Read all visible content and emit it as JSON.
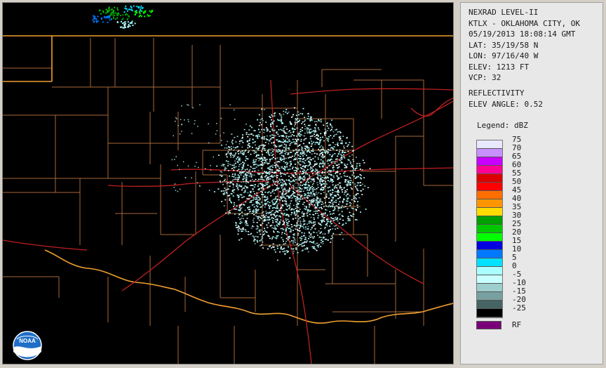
{
  "header": {
    "product_line": "NEXRAD LEVEL-II",
    "station": "KTLX - OKLAHOMA CITY, OK",
    "datetime": "05/19/2013 18:08:14 GMT",
    "lat": "LAT: 35/19/58 N",
    "lon": "LON: 97/16/40 W",
    "elev": "ELEV: 1213 FT",
    "vcp": "VCP: 32"
  },
  "product": {
    "name": "REFLECTIVITY",
    "elev_angle": "ELEV ANGLE: 0.52"
  },
  "legend": {
    "title": "Legend: dBZ",
    "levels": [
      {
        "label": "75",
        "color": "#e8e8ff"
      },
      {
        "label": "70",
        "color": "#c890ff"
      },
      {
        "label": "65",
        "color": "#c800ff"
      },
      {
        "label": "60",
        "color": "#ff0096"
      },
      {
        "label": "55",
        "color": "#dc0000"
      },
      {
        "label": "50",
        "color": "#ff0000"
      },
      {
        "label": "45",
        "color": "#ff6e00"
      },
      {
        "label": "40",
        "color": "#ff9600"
      },
      {
        "label": "35",
        "color": "#ffdc00"
      },
      {
        "label": "30",
        "color": "#00a000"
      },
      {
        "label": "25",
        "color": "#00c800"
      },
      {
        "label": "20",
        "color": "#00ff00"
      },
      {
        "label": "15",
        "color": "#0000e0"
      },
      {
        "label": "10",
        "color": "#0078ff"
      },
      {
        "label": "5",
        "color": "#00e0ff"
      },
      {
        "label": "0",
        "color": "#aaffff"
      },
      {
        "label": "-5",
        "color": "#c8ffff"
      },
      {
        "label": "-10",
        "color": "#9ecdcd"
      },
      {
        "label": "-15",
        "color": "#78a0a0"
      },
      {
        "label": "-20",
        "color": "#466464"
      },
      {
        "label": "-25",
        "color": "#000000"
      }
    ],
    "rf_label": "RF",
    "rf_color": "#7a007a"
  },
  "logo": {
    "icon": "noaa-logo-icon",
    "text": "NOAA"
  },
  "colors": {
    "state_line": "#f0a030",
    "county_line": "#b07040",
    "highway": "#c02020",
    "echo": "#aaffff"
  }
}
